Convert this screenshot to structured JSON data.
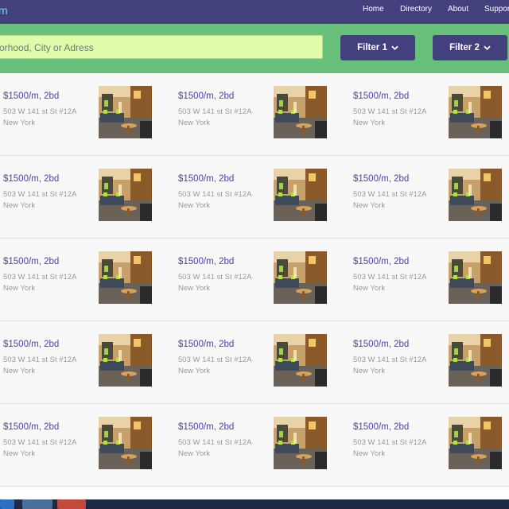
{
  "header": {
    "brand": "m",
    "nav": [
      "Home",
      "Directory",
      "About",
      "Support"
    ]
  },
  "search": {
    "placeholder": "orhood, City or Adress"
  },
  "filters": [
    "Filter 1",
    "Filter 2"
  ],
  "listing": {
    "price": "$1500/m, 2bd",
    "address": "503 W 141 st St #12A",
    "city": "New York"
  },
  "grid": {
    "rows": 5,
    "columns": 3
  },
  "colors": {
    "header": "#43407e",
    "search_band": "#68c07a",
    "search_input": "#e2fbab",
    "price_text": "#4a44a6"
  },
  "icons": {
    "filter_chevron": "chevron-down-icon",
    "taskbar": [
      "start-icon",
      "file-explorer-icon",
      "chrome-icon"
    ]
  }
}
